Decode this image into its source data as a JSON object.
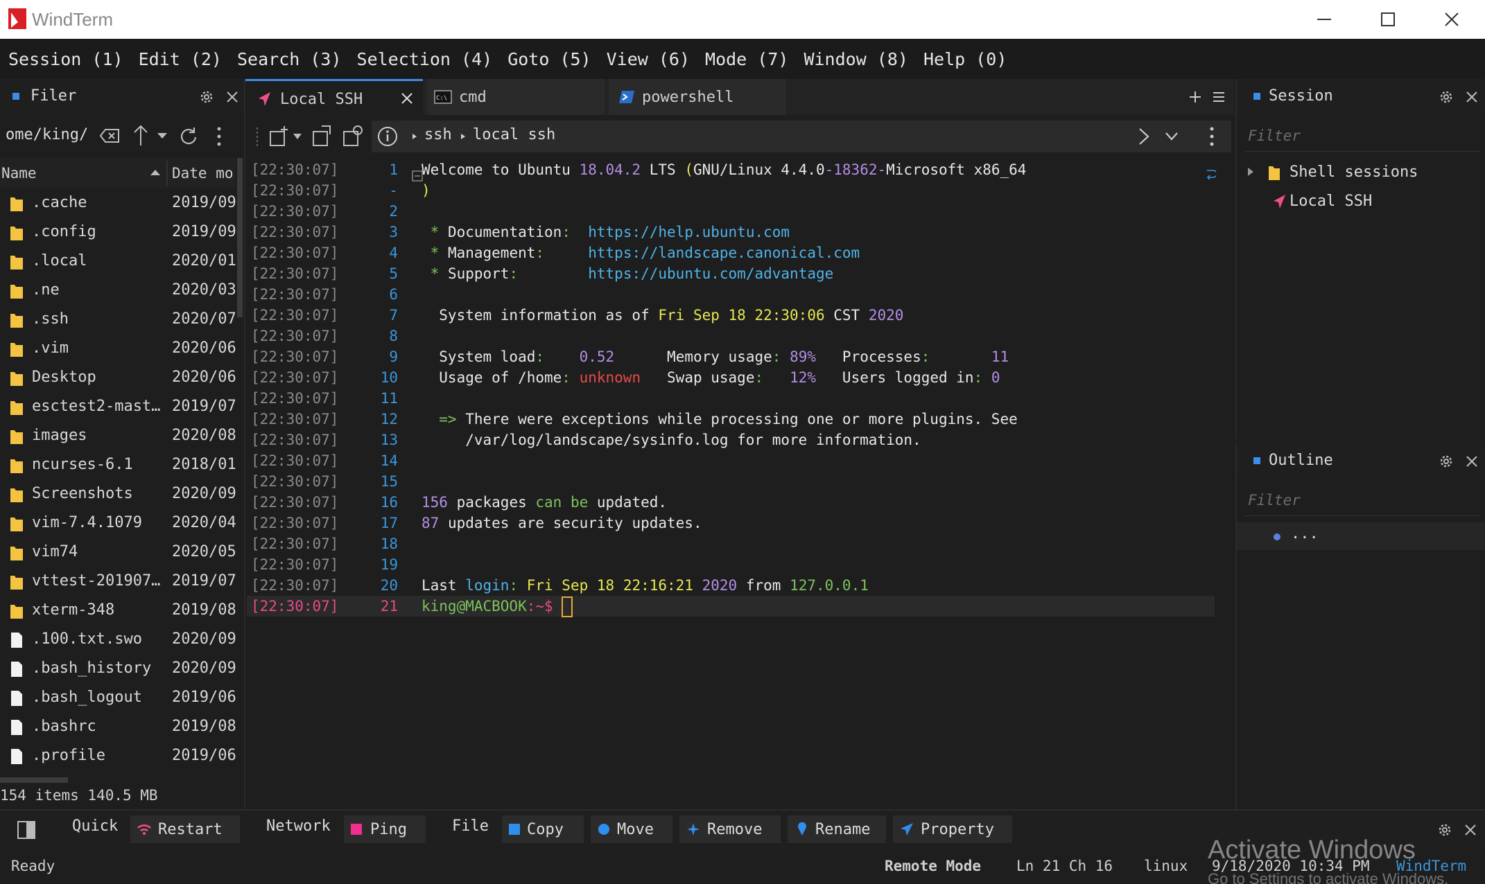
{
  "app": {
    "title": "WindTerm"
  },
  "menu": [
    "Session (1)",
    "Edit (2)",
    "Search (3)",
    "Selection (4)",
    "Goto (5)",
    "View (6)",
    "Mode (7)",
    "Window (8)",
    "Help (0)"
  ],
  "filer": {
    "title": "Filer",
    "path": "ome/king/",
    "columns": {
      "name": "Name",
      "date": "Date mo"
    },
    "items": [
      {
        "name": ".cache",
        "date": "2019/09",
        "kind": "folder"
      },
      {
        "name": ".config",
        "date": "2019/09",
        "kind": "folder"
      },
      {
        "name": ".local",
        "date": "2020/01",
        "kind": "folder"
      },
      {
        "name": ".ne",
        "date": "2020/03",
        "kind": "folder"
      },
      {
        "name": ".ssh",
        "date": "2020/07",
        "kind": "folder"
      },
      {
        "name": ".vim",
        "date": "2020/06",
        "kind": "folder"
      },
      {
        "name": "Desktop",
        "date": "2020/06",
        "kind": "folder"
      },
      {
        "name": "esctest2-mast…",
        "date": "2019/07",
        "kind": "folder"
      },
      {
        "name": "images",
        "date": "2020/08",
        "kind": "folder"
      },
      {
        "name": "ncurses-6.1",
        "date": "2018/01",
        "kind": "folder"
      },
      {
        "name": "Screenshots",
        "date": "2020/09",
        "kind": "folder"
      },
      {
        "name": "vim-7.4.1079",
        "date": "2020/04",
        "kind": "folder"
      },
      {
        "name": "vim74",
        "date": "2020/05",
        "kind": "folder"
      },
      {
        "name": "vttest-201907…",
        "date": "2019/07",
        "kind": "folder"
      },
      {
        "name": "xterm-348",
        "date": "2019/08",
        "kind": "folder"
      },
      {
        "name": ".100.txt.swo",
        "date": "2020/09",
        "kind": "file"
      },
      {
        "name": ".bash_history",
        "date": "2020/09",
        "kind": "file"
      },
      {
        "name": ".bash_logout",
        "date": "2019/06",
        "kind": "file"
      },
      {
        "name": ".bashrc",
        "date": "2019/08",
        "kind": "file"
      },
      {
        "name": ".profile",
        "date": "2019/06",
        "kind": "file"
      }
    ],
    "summary": "154 items 140.5 MB"
  },
  "tabs": [
    {
      "label": "Local SSH",
      "active": true
    },
    {
      "label": "cmd",
      "active": false
    },
    {
      "label": "powershell",
      "active": false
    }
  ],
  "address": {
    "crumb1": "ssh",
    "crumb2": "local ssh"
  },
  "terminal": {
    "timestamp": "[22:30:07]",
    "lines": [
      {
        "ln": "1",
        "segs": [
          {
            "t": "Welcome to Ubuntu ",
            "c": "#e8e8e8"
          },
          {
            "t": "18.04.2",
            "c": "#b48ee6"
          },
          {
            "t": " LTS ",
            "c": "#e8e8e8"
          },
          {
            "t": "(",
            "c": "#e8e852"
          },
          {
            "t": "GNU/Linux 4.4.0",
            "c": "#e8e8e8"
          },
          {
            "t": "-18362-",
            "c": "#b48ee6"
          },
          {
            "t": "Microsoft x86_64",
            "c": "#e8e8e8"
          }
        ]
      },
      {
        "ln": "-",
        "segs": [
          {
            "t": ")",
            "c": "#e8e852"
          }
        ]
      },
      {
        "ln": "2",
        "segs": []
      },
      {
        "ln": "3",
        "segs": [
          {
            "t": " * ",
            "c": "#7ec25b"
          },
          {
            "t": "Documentation",
            "c": "#e8e8e8"
          },
          {
            "t": ":",
            "c": "#7ec25b"
          },
          {
            "t": "  https://help.ubuntu.com",
            "c": "#4fb3e8"
          }
        ]
      },
      {
        "ln": "4",
        "segs": [
          {
            "t": " * ",
            "c": "#7ec25b"
          },
          {
            "t": "Management",
            "c": "#e8e8e8"
          },
          {
            "t": ":",
            "c": "#7ec25b"
          },
          {
            "t": "     https://landscape.canonical.com",
            "c": "#4fb3e8"
          }
        ]
      },
      {
        "ln": "5",
        "segs": [
          {
            "t": " * ",
            "c": "#7ec25b"
          },
          {
            "t": "Support",
            "c": "#e8e8e8"
          },
          {
            "t": ":",
            "c": "#7ec25b"
          },
          {
            "t": "        https://ubuntu.com/advantage",
            "c": "#4fb3e8"
          }
        ]
      },
      {
        "ln": "6",
        "segs": []
      },
      {
        "ln": "7",
        "segs": [
          {
            "t": "  System information as of ",
            "c": "#e8e8e8"
          },
          {
            "t": "Fri Sep ",
            "c": "#e8e852"
          },
          {
            "t": "18 22:30:06",
            "c": "#e8e852"
          },
          {
            "t": " CST ",
            "c": "#e8e8e8"
          },
          {
            "t": "2020",
            "c": "#b48ee6"
          }
        ]
      },
      {
        "ln": "8",
        "segs": []
      },
      {
        "ln": "9",
        "segs": [
          {
            "t": "  System load",
            "c": "#e8e8e8"
          },
          {
            "t": ":",
            "c": "#7ec25b"
          },
          {
            "t": "    0.52",
            "c": "#b48ee6"
          },
          {
            "t": "      Memory usage",
            "c": "#e8e8e8"
          },
          {
            "t": ":",
            "c": "#7ec25b"
          },
          {
            "t": " 89%",
            "c": "#b48ee6"
          },
          {
            "t": "   Processes",
            "c": "#e8e8e8"
          },
          {
            "t": ":",
            "c": "#7ec25b"
          },
          {
            "t": "       11",
            "c": "#b48ee6"
          }
        ]
      },
      {
        "ln": "10",
        "segs": [
          {
            "t": "  Usage of /home",
            "c": "#e8e8e8"
          },
          {
            "t": ":",
            "c": "#7ec25b"
          },
          {
            "t": " unknown",
            "c": "#e84a4a"
          },
          {
            "t": "   Swap usage",
            "c": "#e8e8e8"
          },
          {
            "t": ":",
            "c": "#7ec25b"
          },
          {
            "t": "   12%",
            "c": "#b48ee6"
          },
          {
            "t": "   Users logged in",
            "c": "#e8e8e8"
          },
          {
            "t": ":",
            "c": "#7ec25b"
          },
          {
            "t": " 0",
            "c": "#b48ee6"
          }
        ]
      },
      {
        "ln": "11",
        "segs": []
      },
      {
        "ln": "12",
        "segs": [
          {
            "t": "  => ",
            "c": "#7ec25b"
          },
          {
            "t": "There were exceptions while processing one or more plugins. See",
            "c": "#e8e8e8"
          }
        ]
      },
      {
        "ln": "13",
        "segs": [
          {
            "t": "     /var/log/landscape/sysinfo.log for more information.",
            "c": "#e8e8e8"
          }
        ]
      },
      {
        "ln": "14",
        "segs": []
      },
      {
        "ln": "15",
        "segs": []
      },
      {
        "ln": "16",
        "segs": [
          {
            "t": "156",
            "c": "#b48ee6"
          },
          {
            "t": " packages ",
            "c": "#e8e8e8"
          },
          {
            "t": "can be",
            "c": "#7ec25b"
          },
          {
            "t": " updated.",
            "c": "#e8e8e8"
          }
        ]
      },
      {
        "ln": "17",
        "segs": [
          {
            "t": "87",
            "c": "#b48ee6"
          },
          {
            "t": " updates are security updates.",
            "c": "#e8e8e8"
          }
        ]
      },
      {
        "ln": "18",
        "segs": []
      },
      {
        "ln": "19",
        "segs": []
      },
      {
        "ln": "20",
        "segs": [
          {
            "t": "Last ",
            "c": "#e8e8e8"
          },
          {
            "t": "login",
            "c": "#4fb3e8"
          },
          {
            "t": ": ",
            "c": "#7ec25b"
          },
          {
            "t": "Fri Sep ",
            "c": "#e8e852"
          },
          {
            "t": "18 22:16:21",
            "c": "#e8e852"
          },
          {
            "t": " ",
            "c": "#e8e8e8"
          },
          {
            "t": "2020",
            "c": "#b48ee6"
          },
          {
            "t": " from ",
            "c": "#e8e8e8"
          },
          {
            "t": "127.0.0.1",
            "c": "#7ec25b"
          }
        ]
      },
      {
        "ln": "21",
        "segs": [
          {
            "t": "king@MACBOOK",
            "c": "#7ec25b"
          },
          {
            "t": ":~$ ",
            "c": "#e84a8a"
          }
        ]
      }
    ]
  },
  "session_panel": {
    "title": "Session",
    "filter_placeholder": "Filter",
    "tree": [
      {
        "label": "Shell sessions"
      },
      {
        "label": "Local SSH"
      }
    ]
  },
  "outline_panel": {
    "title": "Outline",
    "filter_placeholder": "Filter",
    "item": "..."
  },
  "bottombar": {
    "quick": "Quick",
    "restart": "Restart",
    "network": "Network",
    "ping": "Ping",
    "file": "File",
    "copy": "Copy",
    "move": "Move",
    "remove": "Remove",
    "rename": "Rename",
    "property": "Property"
  },
  "status": {
    "ready": "Ready",
    "mode": "Remote Mode",
    "position": "Ln 21 Ch 16",
    "os": "linux",
    "datetime": "9/18/2020 10:34 PM",
    "brand": "WindTerm"
  },
  "watermark": {
    "line1": "Activate Windows",
    "line2": "Go to Settings to activate Windows."
  },
  "colors": {
    "accent": "#3b8ee8",
    "prompt_highlight": "#e84a8a",
    "line_numbers": "#3a96dd"
  }
}
